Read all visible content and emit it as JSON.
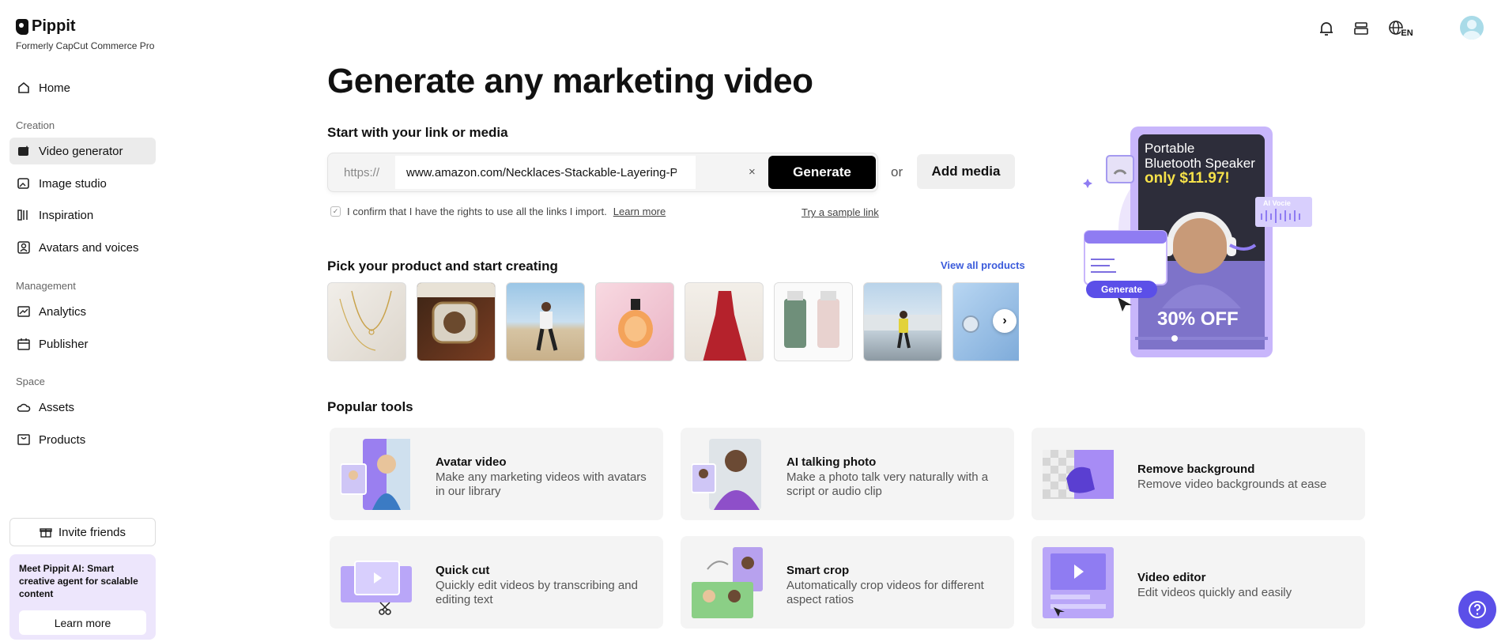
{
  "brand": {
    "name": "Pippit",
    "formerly": "Formerly CapCut Commerce Pro"
  },
  "nav": {
    "home": "Home",
    "creation_label": "Creation",
    "video_generator": "Video generator",
    "image_studio": "Image studio",
    "inspiration": "Inspiration",
    "avatars_voices": "Avatars and voices",
    "management_label": "Management",
    "analytics": "Analytics",
    "publisher": "Publisher",
    "space_label": "Space",
    "assets": "Assets",
    "products": "Products"
  },
  "sidebar_footer": {
    "invite": "Invite friends",
    "promo_text": "Meet Pippit AI: Smart creative agent for scalable content",
    "learn_more": "Learn more"
  },
  "header": {
    "language": "EN"
  },
  "main": {
    "title": "Generate any marketing video",
    "start_heading": "Start with your link or media",
    "url_prefix": "https://",
    "url_value": "www.amazon.com/Necklaces-Stackable-Layering-Paperclip-Necklace",
    "clear": "×",
    "generate": "Generate",
    "or": "or",
    "add_media": "Add media",
    "confirm_text": "I confirm that I have the rights to use all the links I import.",
    "confirm_learn": "Learn more",
    "sample_link": "Try a sample link",
    "pick_heading": "Pick your product and start creating",
    "view_all": "View all products"
  },
  "hero": {
    "line1": "Portable",
    "line2": "Bluetooth Speaker",
    "price": "only $11.97!",
    "discount": "30% OFF",
    "ai_voice": "AI Vocie",
    "generate": "Generate"
  },
  "popular": {
    "heading": "Popular tools",
    "tools": [
      {
        "title": "Avatar video",
        "desc": "Make any marketing videos with avatars in our library"
      },
      {
        "title": "AI talking photo",
        "desc": "Make a photo talk very naturally with a script or audio clip"
      },
      {
        "title": "Remove background",
        "desc": "Remove video backgrounds at ease"
      },
      {
        "title": "Quick cut",
        "desc": "Quickly edit videos by transcribing and editing text"
      },
      {
        "title": "Smart crop",
        "desc": "Automatically crop videos for different aspect ratios"
      },
      {
        "title": "Video editor",
        "desc": "Edit videos quickly and easily"
      }
    ]
  },
  "colors": {
    "accent": "#5b4fe8",
    "hero_purple": "#c8b6fb",
    "link_blue": "#3b5bdb"
  }
}
